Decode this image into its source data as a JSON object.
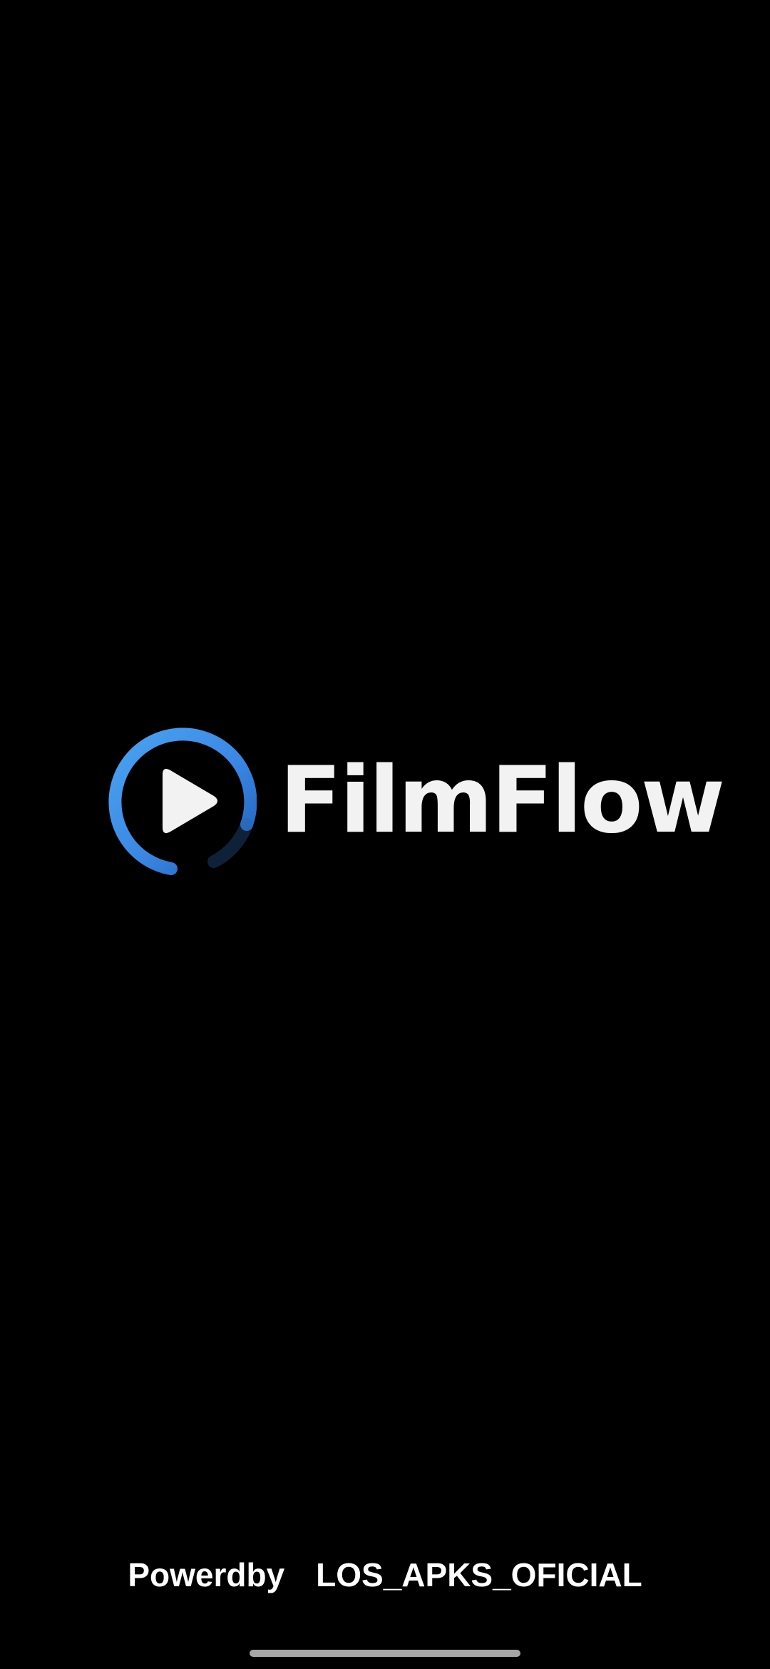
{
  "app": {
    "name": "FilmFlow"
  },
  "logo": {
    "icon": "play-circle-icon",
    "ring_color": "#3f8ee8",
    "play_color": "#f2f2f2"
  },
  "footer": {
    "powered_label": "Powerdby",
    "powered_name": "LOS_APKS_OFICIAL"
  }
}
